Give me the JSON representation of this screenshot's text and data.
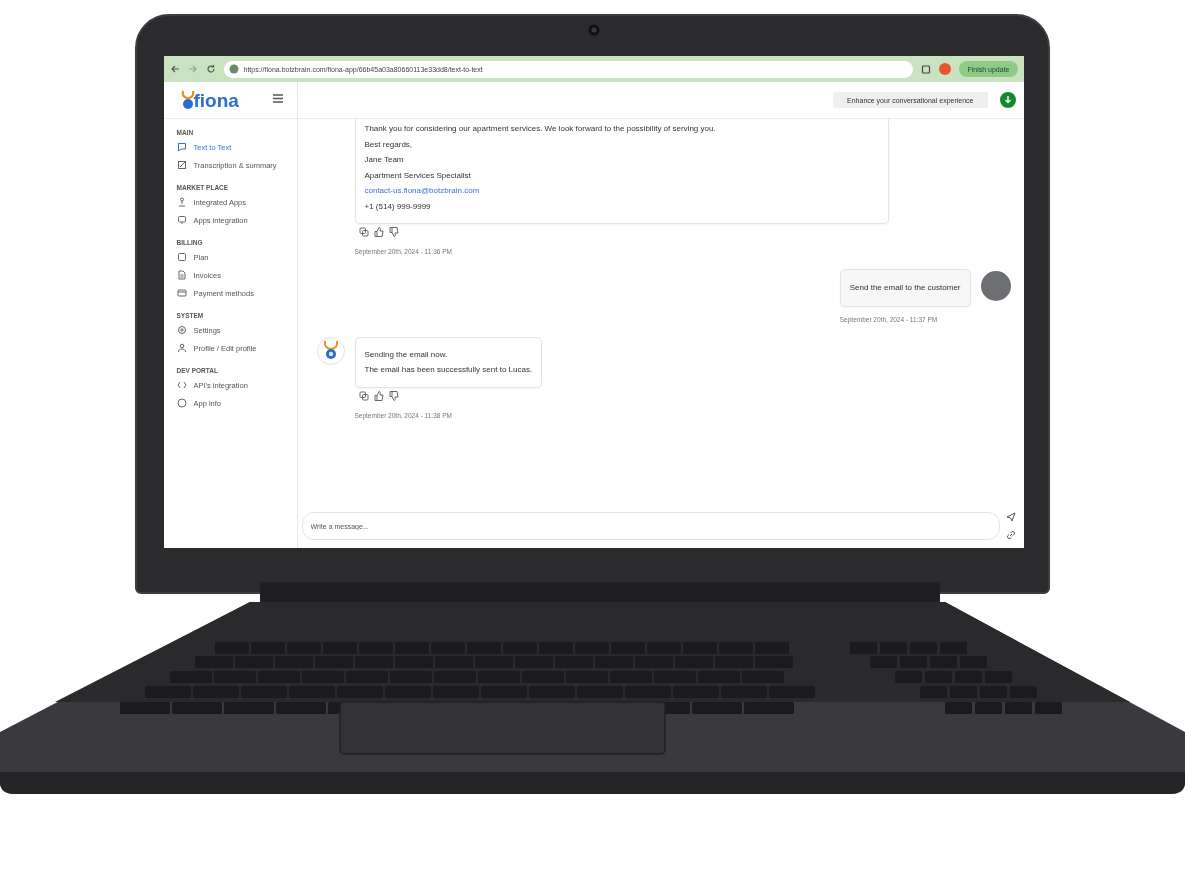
{
  "browser": {
    "url": "https://fiona.botzbrain.com/fiona-app/66b45a03a80660113e33dd8/text-to-text",
    "update_button": "Finish update"
  },
  "sidebar": {
    "logo": "fiona",
    "sections": [
      {
        "heading": "MAIN",
        "items": [
          {
            "label": "Text to Text",
            "selected": true
          },
          {
            "label": "Transcription & summary",
            "selected": false
          }
        ]
      },
      {
        "heading": "MARKET PLACE",
        "items": [
          {
            "label": "Integrated Apps",
            "selected": false
          },
          {
            "label": "Apps integration",
            "selected": false
          }
        ]
      },
      {
        "heading": "BILLING",
        "items": [
          {
            "label": "Plan",
            "selected": false
          },
          {
            "label": "Invoices",
            "selected": false
          },
          {
            "label": "Payment methods",
            "selected": false
          }
        ]
      },
      {
        "heading": "SYSTEM",
        "items": [
          {
            "label": "Settings",
            "selected": false
          },
          {
            "label": "Profile / Edit profile",
            "selected": false
          }
        ]
      },
      {
        "heading": "DEV PORTAL",
        "items": [
          {
            "label": "API's integration",
            "selected": false
          },
          {
            "label": "App info",
            "selected": false
          }
        ]
      }
    ]
  },
  "header": {
    "button": "Enhance your conversational experience"
  },
  "messages": [
    {
      "kind": "bot",
      "avatar": false,
      "lines": [
        {
          "kind": "text",
          "text": "Thank you for considering our apartment services. We look forward to the possibility of serving you."
        },
        {
          "kind": "text",
          "text": "Best regards,"
        },
        {
          "kind": "text",
          "text": "Jane Team"
        },
        {
          "kind": "text",
          "text": "Apartment Services Specialist"
        },
        {
          "kind": "link",
          "text": "contact-us.fiona@botzbrain.com"
        },
        {
          "kind": "text",
          "text": "+1 (514) 999-9999"
        }
      ],
      "timestamp": "September 20th, 2024 - 11:36 PM"
    },
    {
      "kind": "user",
      "avatar": true,
      "lines": [
        {
          "kind": "text",
          "text": "Send the email to the customer"
        }
      ],
      "timestamp": "September 20th, 2024 - 11:37 PM"
    },
    {
      "kind": "bot",
      "avatar": true,
      "lines": [
        {
          "kind": "text",
          "text": "Sending the email now."
        },
        {
          "kind": "text",
          "text": "The email has been successfully sent to Lucas."
        }
      ],
      "timestamp": "September 20th, 2024 - 11:38 PM"
    }
  ],
  "composer": {
    "placeholder": "Write a message..."
  }
}
